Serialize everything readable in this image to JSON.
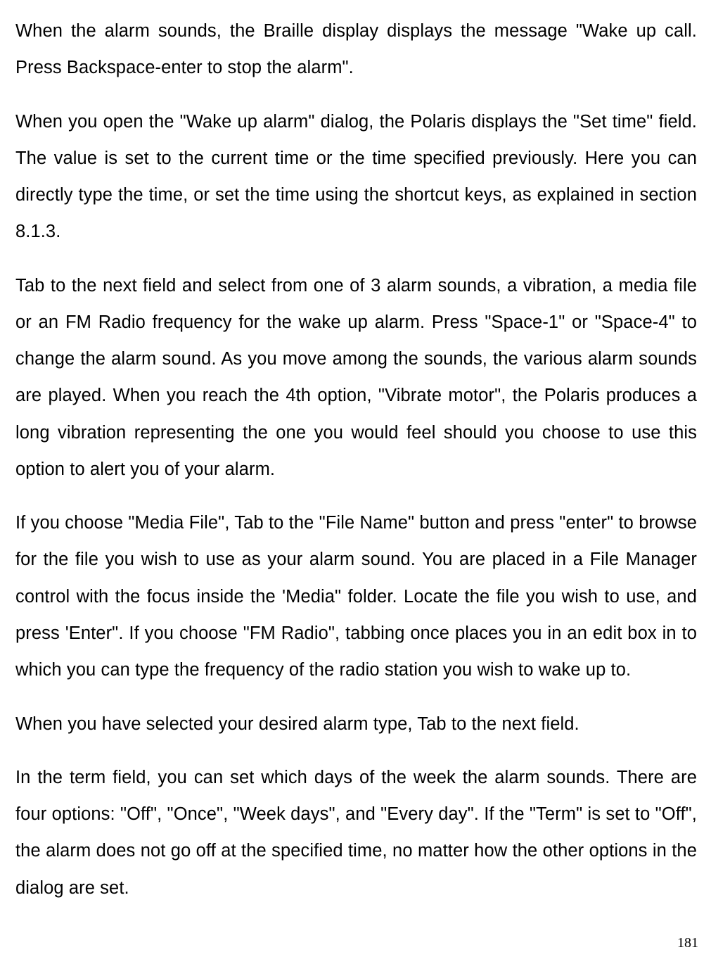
{
  "paragraphs": {
    "p1": "When the alarm sounds, the Braille display displays the message \"Wake up call. Press Backspace-enter to stop the alarm\".",
    "p2": "When you open the \"Wake up alarm\" dialog, the Polaris displays the \"Set time\" field. The value is set to the current time or the time specified previously. Here you can directly type the time, or set the time using the shortcut keys, as explained in section 8.1.3.",
    "p3": "Tab to the next field and select from one of 3 alarm sounds, a vibration, a media file or an FM Radio frequency for the wake up alarm. Press \"Space-1\" or \"Space-4\" to change the alarm sound. As you move among the sounds, the various alarm sounds are played. When you reach the 4th option, \"Vibrate motor\", the Polaris produces a long vibration representing the one you would feel should you choose to use this option to alert you of your alarm.",
    "p4": "If you choose \"Media File\", Tab to the \"File Name\" button and press \"enter\" to browse for the file you wish to use as your alarm sound. You are placed in a File Manager control with the focus inside the 'Media\" folder. Locate the file you wish to use, and press 'Enter\". If you choose \"FM Radio\", tabbing once places you in an edit box in to which you can type the frequency of the radio station you wish to wake up to.",
    "p5": "When you have selected your desired alarm type, Tab to the next field.",
    "p6": "In the term field, you can set which days of the week the alarm sounds. There are four options: \"Off\", \"Once\", \"Week days\", and \"Every day\". If the \"Term\" is set to \"Off\", the alarm does not go off at the specified time, no matter how the other options in the dialog are set."
  },
  "page_number": "181"
}
